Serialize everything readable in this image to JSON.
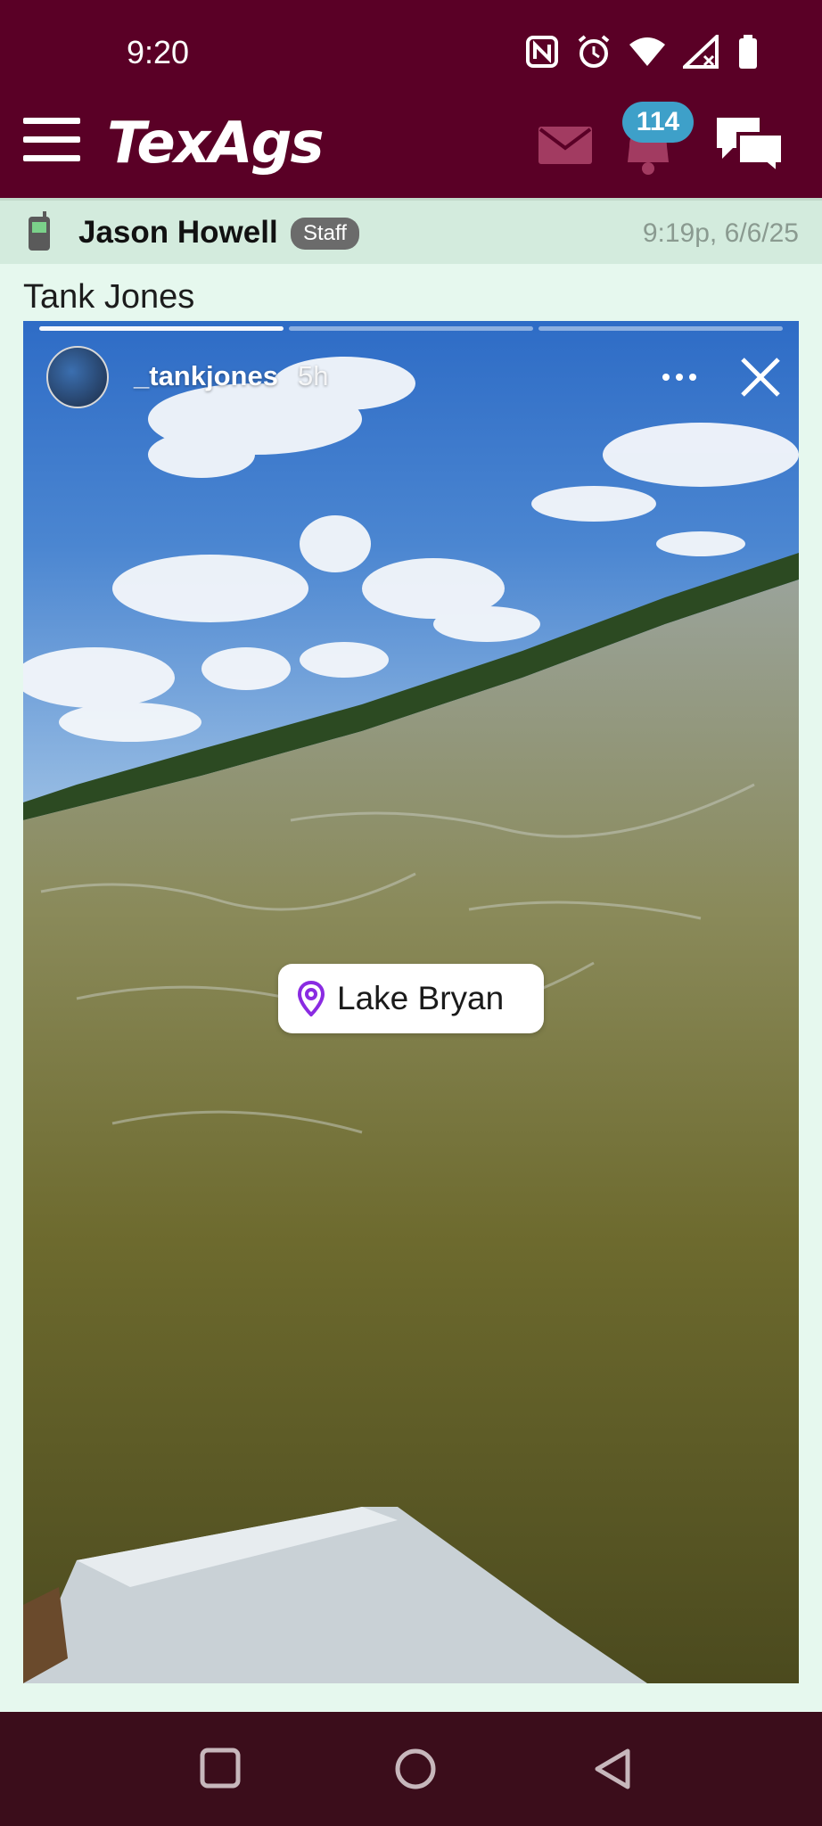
{
  "status_bar": {
    "time": "9:20"
  },
  "header": {
    "logo": "TexAgs",
    "notification_count": "114"
  },
  "post": {
    "author": "Jason Howell",
    "role_badge": "Staff",
    "timestamp": "9:19p, 6/6/25",
    "title": "Tank Jones"
  },
  "story": {
    "username": "_tankjones",
    "age": "5h",
    "location": "Lake Bryan"
  },
  "colors": {
    "header_bg": "#5a0026",
    "badge_bg": "#3ea0c9",
    "page_bg": "#e6f8ee",
    "location_pin": "#8a2be2"
  },
  "icons": [
    "menu-icon",
    "mail-icon",
    "bell-icon",
    "chat-icon",
    "phone-icon",
    "more-icon",
    "close-icon",
    "location-pin-icon",
    "square-icon",
    "circle-icon",
    "back-triangle-icon"
  ]
}
